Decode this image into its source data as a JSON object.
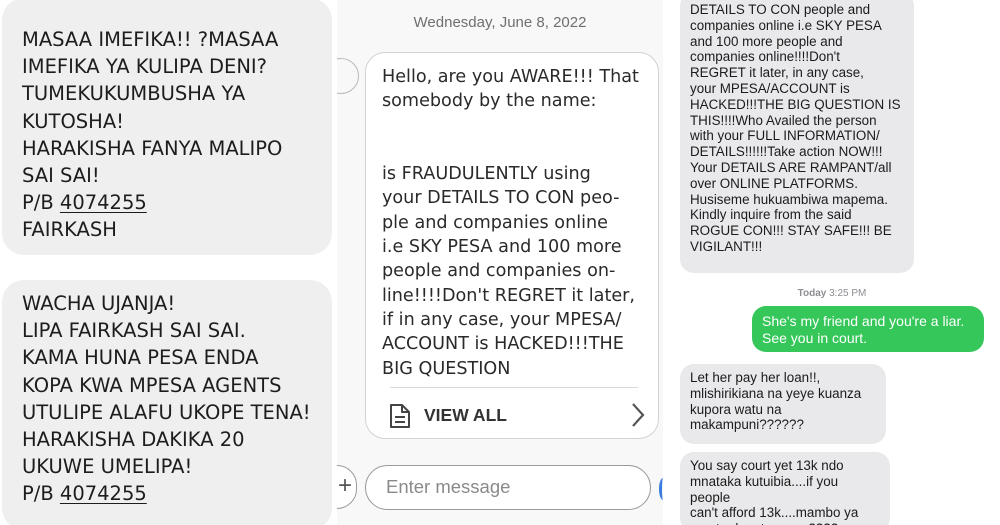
{
  "left": {
    "message1": {
      "text": "MASAA IMEFIKA!! ?MASAA\nIMEFIKA YA KULIPA DENI?\nTUMEKUKUMBUSHA YA\nKUTOSHA!\nHARAKISHA FANYA MALIPO\nSAI SAI!\nP/B ",
      "paybill": "4074255",
      "sender": "FAIRKASH"
    },
    "message2": {
      "text": "WACHA UJANJA!\nLIPA FAIRKASH SAI SAI.\nKAMA HUNA PESA ENDA\nKOPA KWA MPESA AGENTS\nUTULIPE ALAFU UKOPE TENA!\nHARAKISHA DAKIKA 20\nUKUWE UMELIPA!\nP/B ",
      "paybill": "4074255"
    }
  },
  "middle": {
    "date": "Wednesday, June 8, 2022",
    "message": "Hello, are you AWARE!!! That\nsomebody by the name:\n\n\nis FRAUDULENTLY using\nyour DETAILS TO CON peo-\nple and companies online\ni.e SKY PESA and 100 more\npeople and companies on-\nline!!!!Don't REGRET it later,\nif in any case, your MPESA/\nACCOUNT is HACKED!!!THE\nBIG QUESTION",
    "view_all": "VIEW ALL",
    "input_placeholder": "Enter message",
    "attach_icon": "+"
  },
  "right": {
    "incoming1": "DETAILS TO CON people and\ncompanies online i.e SKY PESA\nand 100 more people and\ncompanies online!!!!Don't\nREGRET it later, in any case,\nyour MPESA/ACCOUNT is\nHACKED!!!THE BIG QUESTION IS\nTHIS!!!!Who Availed the person\nwith your FULL INFORMATION/\nDETAILS!!!!!!Take action NOW!!!\nYour DETAILS ARE RAMPANT/all\nover ONLINE PLATFORMS.\nHusiseme hukuambiwa mapema.\nKindly inquire from the said\nROGUE CON!!! STAY SAFE!!! BE\nVIGILANT!!!",
    "timestamp_day": "Today",
    "timestamp_time": "3:25 PM",
    "outgoing": "She's my friend and you're a liar.\nSee you in court.",
    "incoming2": "Let her pay her loan!!,\nmlishirikiana na yeye kuanza\nkupora watu na\nmakampuni??????",
    "incoming3": "You say court yet 13k ndo\nmnataka kutuibia....if you people\ncan't afford 13k....mambo ya\ncourt ndo mtaezana????"
  },
  "colors": {
    "left_bubble": "#efefef",
    "outgoing_green": "#35c759",
    "incoming_gray": "#e9e9eb"
  }
}
